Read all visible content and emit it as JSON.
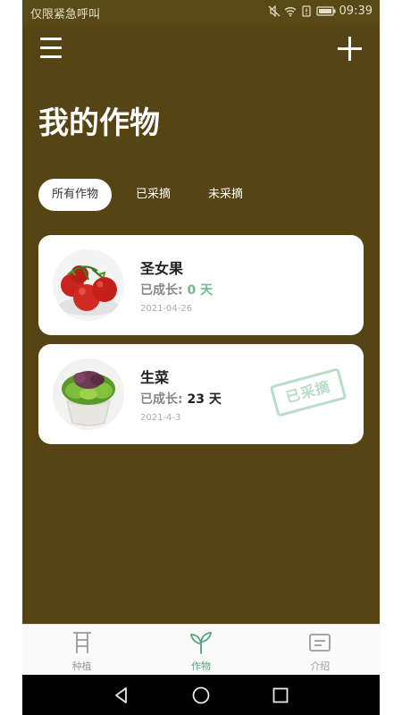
{
  "status_bar": {
    "carrier_text": "仅限紧急呼叫",
    "time": "09:39",
    "icons": [
      "mute-icon",
      "wifi-icon",
      "sim-alert-icon",
      "battery-icon"
    ]
  },
  "header": {
    "menu_icon": "hamburger-menu-icon",
    "add_icon": "plus-icon",
    "title": "我的作物"
  },
  "filters": {
    "active_index": 0,
    "items": [
      {
        "label": "所有作物"
      },
      {
        "label": "已采摘"
      },
      {
        "label": "未采摘"
      }
    ]
  },
  "crops": [
    {
      "name": "圣女果",
      "growth_label": "已成长:",
      "growth_value": "0 天",
      "date": "2021-04-26",
      "image": "cherry-tomato-photo",
      "stamp": ""
    },
    {
      "name": "生菜",
      "growth_label": "已成长:",
      "growth_value": "23 天",
      "date": "2021-4-3",
      "image": "lettuce-photo",
      "stamp": "已采摘"
    }
  ],
  "bottom_tabs": {
    "active_index": 1,
    "items": [
      {
        "label": "种植",
        "icon": "planting-rack-icon"
      },
      {
        "label": "作物",
        "icon": "sprout-icon"
      },
      {
        "label": "介绍",
        "icon": "info-card-icon"
      }
    ]
  },
  "system_nav": [
    "back-icon",
    "home-icon",
    "recents-icon"
  ],
  "colors": {
    "header_bg": "#574414",
    "accent": "#4fa77a",
    "days_green": "#6dbd8d",
    "stamp": "#b8ddc8"
  }
}
